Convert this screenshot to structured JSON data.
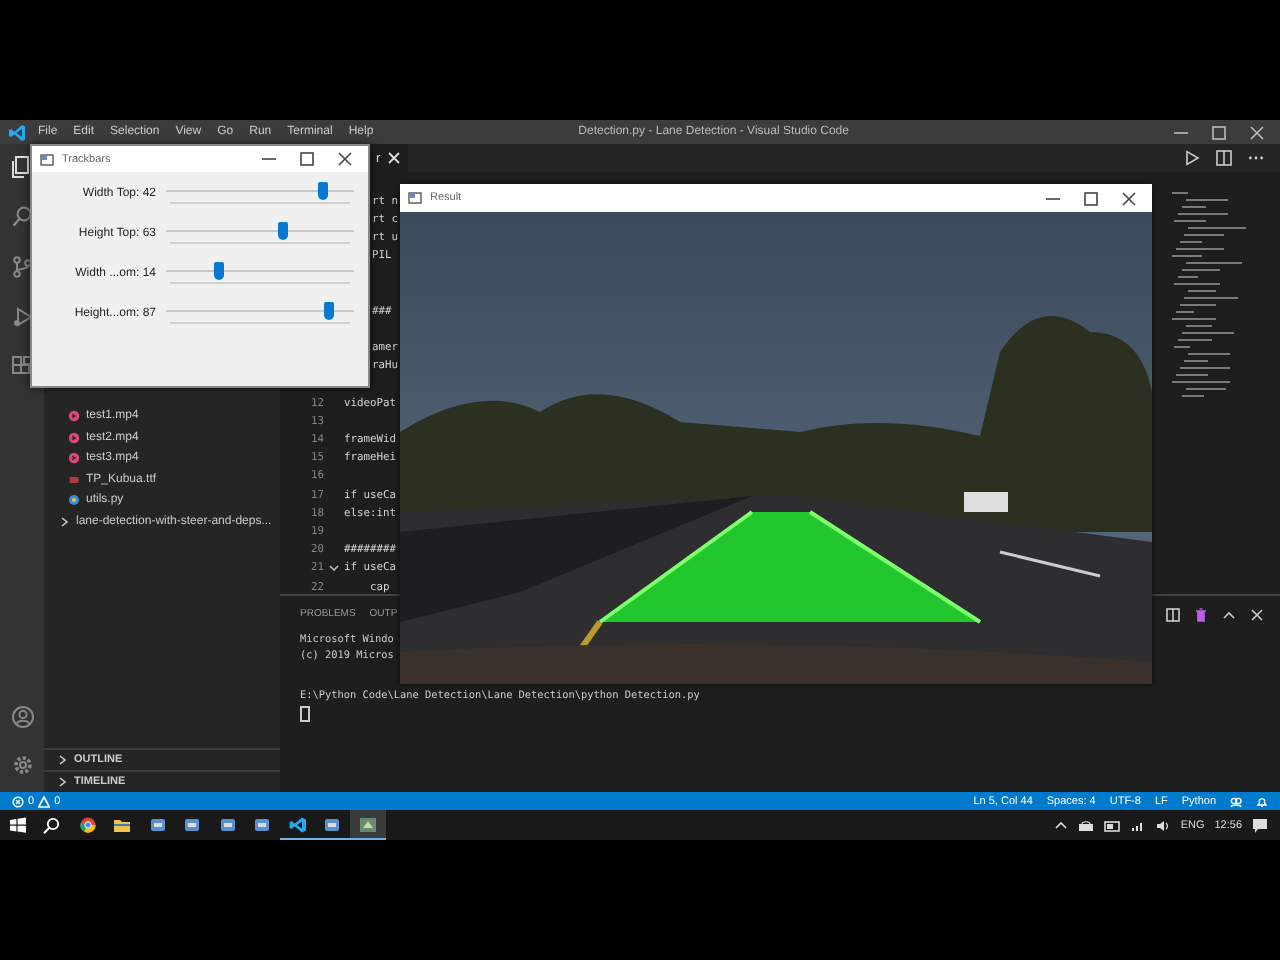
{
  "vscode": {
    "menu": [
      "File",
      "Edit",
      "Selection",
      "View",
      "Go",
      "Run",
      "Terminal",
      "Help"
    ],
    "title": "Detection.py - Lane Detection - Visual Studio Code",
    "editor_tab": {
      "label": "r"
    },
    "explorer_items": [
      {
        "label": "test1.mp4",
        "kind": "video"
      },
      {
        "label": "test2.mp4",
        "kind": "video"
      },
      {
        "label": "test3.mp4",
        "kind": "video"
      },
      {
        "label": "TP_Kubua.ttf",
        "kind": "font"
      },
      {
        "label": "utils.py",
        "kind": "python"
      },
      {
        "label": "lane-detection-with-steer-and-deps...",
        "kind": "folder",
        "expanded": false
      }
    ],
    "sections": [
      {
        "label": "OUTLINE",
        "expanded": false
      },
      {
        "label": "TIMELINE",
        "expanded": false
      }
    ],
    "code_lines": [
      {
        "kind": "partial",
        "text": "rt n"
      },
      {
        "kind": "partial",
        "text": "rt c"
      },
      {
        "kind": "partial",
        "text": "rt u"
      },
      {
        "kind": "partial",
        "text": "PIL"
      },
      {
        "kind": "blank"
      },
      {
        "kind": "blank"
      },
      {
        "kind": "partial",
        "text": "###"
      },
      {
        "kind": "blank"
      },
      {
        "kind": "partial",
        "text": "amer"
      },
      {
        "kind": "partial",
        "text": "raHu"
      },
      {
        "kind": "blank"
      },
      {
        "kind": "line",
        "number": "12",
        "text": "videoPat"
      },
      {
        "kind": "line",
        "number": "13"
      },
      {
        "kind": "line",
        "number": "14",
        "text": "frameWid"
      },
      {
        "kind": "line",
        "number": "15",
        "text": "frameHei"
      },
      {
        "kind": "line",
        "number": "16"
      },
      {
        "kind": "line",
        "number": "17",
        "text": "if useCa"
      },
      {
        "kind": "line",
        "number": "18",
        "text": "else:int"
      },
      {
        "kind": "line",
        "number": "19"
      },
      {
        "kind": "line",
        "number": "20",
        "text": "########"
      },
      {
        "kind": "fold",
        "number": "21",
        "text": "if useCa"
      },
      {
        "kind": "line",
        "number": "22",
        "text": "    cap"
      }
    ],
    "panel_tabs": [
      "PROBLEMS",
      "OUTP"
    ],
    "terminal": {
      "banner": [
        "Microsoft Windo",
        "(c) 2019 Micros"
      ],
      "command": "E:\\Python Code\\Lane Detection\\Lane Detection\\python Detection.py"
    },
    "status_bar": {
      "errors": "0",
      "warnings": "0",
      "items": [
        "Ln 5, Col 44",
        "Spaces: 4",
        "UTF-8",
        "LF",
        "Python"
      ]
    }
  },
  "trackbars_window": {
    "title": "Trackbars",
    "sliders": [
      {
        "label": "Width Top: 42",
        "level": 0.83
      },
      {
        "label": "Height Top: 63",
        "level": 0.62
      },
      {
        "label": "Width ...om: 14",
        "level": 0.28
      },
      {
        "label": "Height...om: 87",
        "level": 0.86
      }
    ]
  },
  "result_window": {
    "title": "Result"
  },
  "taskbar": {
    "apps": [
      {
        "kind": "start",
        "running": false,
        "selected": false
      },
      {
        "kind": "search",
        "running": false,
        "selected": false
      },
      {
        "kind": "browser",
        "running": false,
        "selected": false
      },
      {
        "kind": "folder",
        "running": false,
        "selected": false
      },
      {
        "kind": "app",
        "running": false,
        "selected": false
      },
      {
        "kind": "app",
        "running": false,
        "selected": false
      },
      {
        "kind": "app",
        "running": false,
        "selected": false
      },
      {
        "kind": "app",
        "running": false,
        "selected": false
      },
      {
        "kind": "code",
        "running": true,
        "selected": false
      },
      {
        "kind": "app",
        "running": true,
        "selected": false
      },
      {
        "kind": "python",
        "running": true,
        "selected": true
      }
    ],
    "language": "ENG",
    "time": "12:56"
  }
}
